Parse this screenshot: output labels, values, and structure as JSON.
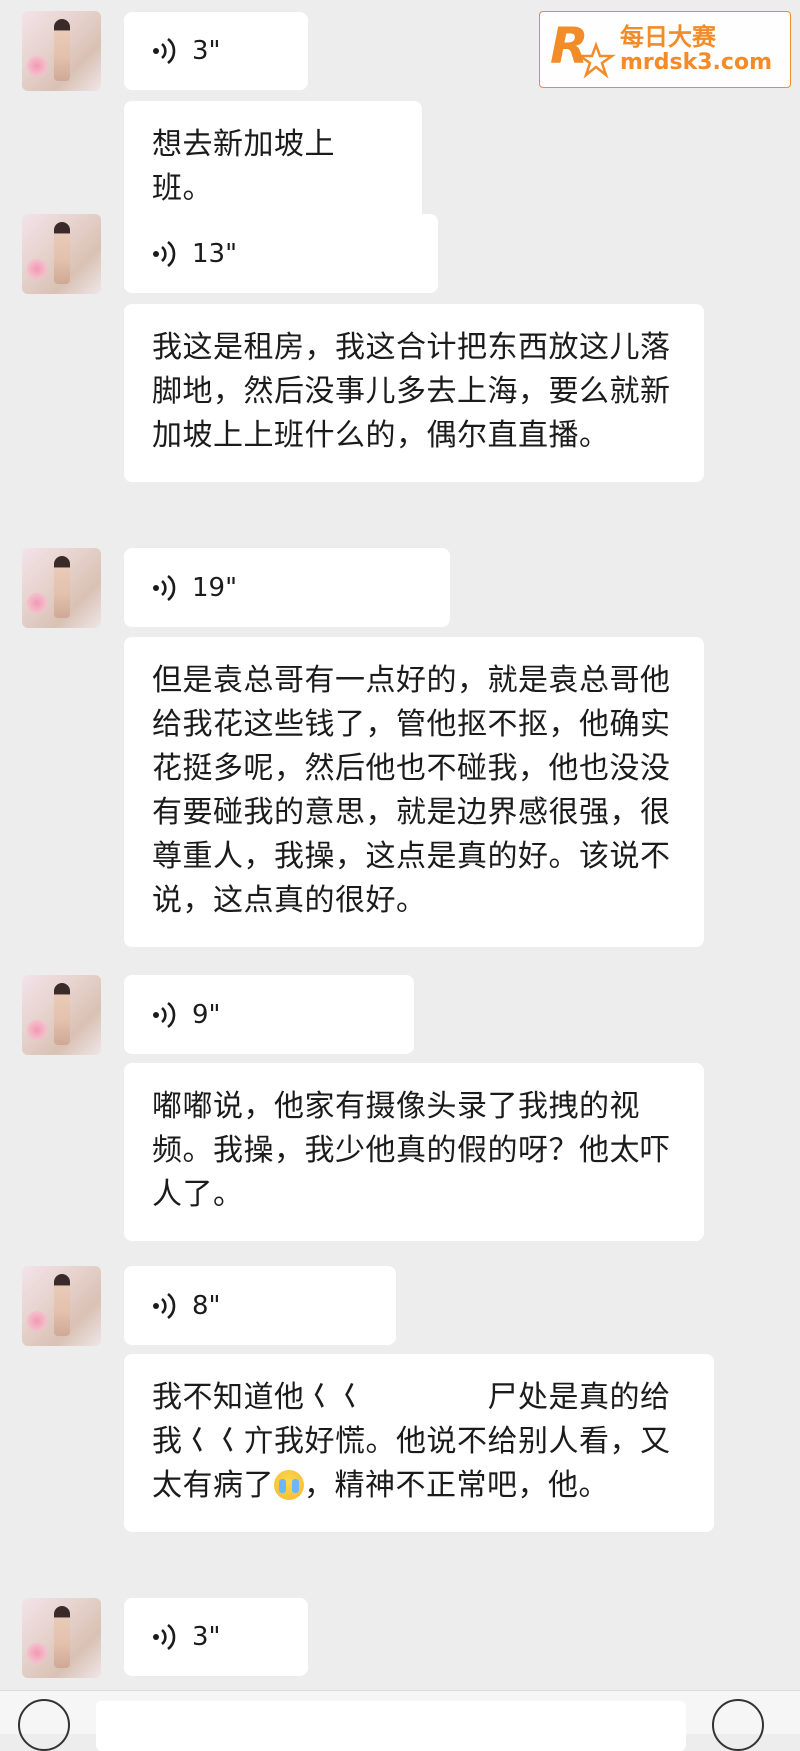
{
  "watermark": {
    "title": "每日大赛",
    "url": "mrdsk3.com",
    "color": "#f28c28"
  },
  "messages": [
    {
      "voice_duration": "3\""
    },
    {
      "text": "想去新加坡上班。"
    },
    {
      "voice_duration": "13\""
    },
    {
      "text": "我这是租房，我这合计把东西放这儿落脚地，然后没事儿多去上海，要么就新加坡上上班什么的，偶尔直直播。"
    },
    {
      "voice_duration": "19\""
    },
    {
      "text": "但是袁总哥有一点好的，就是袁总哥他给我花这些钱了，管他抠不抠，他确实花挺多呢，然后他也不碰我，他也没没有要碰我的意思，就是边界感很强，很尊重人，我操，这点是真的好。该说不说，这点真的很好。"
    },
    {
      "voice_duration": "9\""
    },
    {
      "text": "嘟嘟说，他家有摄像头录了我拽的视频。我操，我少他真的假的呀？他太吓人了。"
    },
    {
      "voice_duration": "8\""
    },
    {
      "text_before_emoji": "我不知道他𡿨𡿨　　　　尸处是真的给我𡿨𡿨亣我好慌。他说不给别人看，又太有病了",
      "emoji": "crying-emoji",
      "text_after_emoji": "，精神不正常吧，他。"
    },
    {
      "voice_duration": "3\""
    }
  ],
  "bottom_bar": {
    "voice_icon": "voice-mode-icon",
    "emoji_icon": "emoji-face-icon"
  }
}
